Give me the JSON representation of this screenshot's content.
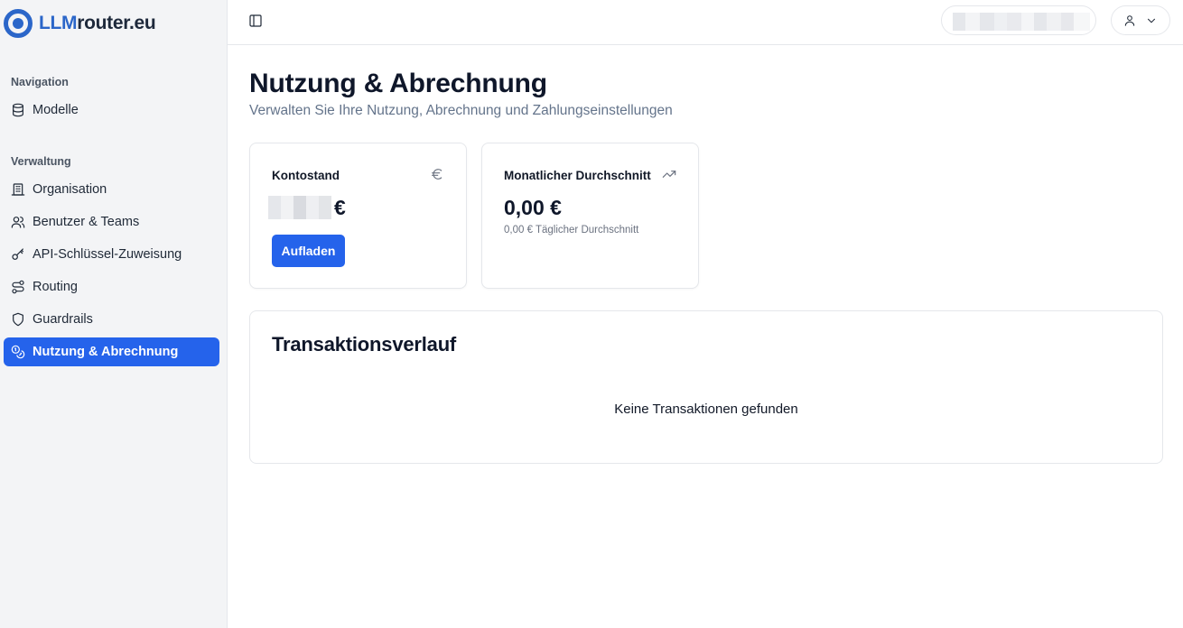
{
  "brand": {
    "prefix": "LLM",
    "suffix": "router.eu"
  },
  "sidebar": {
    "sections": [
      {
        "label": "Navigation",
        "items": [
          {
            "label": "Modelle",
            "icon": "database-icon"
          }
        ]
      },
      {
        "label": "Verwaltung",
        "items": [
          {
            "label": "Organisation",
            "icon": "building-icon"
          },
          {
            "label": "Benutzer & Teams",
            "icon": "users-icon"
          },
          {
            "label": "API-Schlüssel-Zuweisung",
            "icon": "key-icon"
          },
          {
            "label": "Routing",
            "icon": "route-icon"
          },
          {
            "label": "Guardrails",
            "icon": "shield-icon"
          },
          {
            "label": "Nutzung & Abrechnung",
            "icon": "coins-icon",
            "active": true
          }
        ]
      }
    ]
  },
  "main": {
    "title": "Nutzung & Abrechnung",
    "subtitle": "Verwalten Sie Ihre Nutzung, Abrechnung und Zahlungseinstellungen",
    "balance_card": {
      "title": "Kontostand",
      "icon": "euro-icon",
      "currency": "€",
      "button": "Aufladen"
    },
    "average_card": {
      "title": "Monatlicher Durchschnitt",
      "icon": "trending-up-icon",
      "value": "0,00 €",
      "note": "0,00 € Täglicher Durchschnitt"
    },
    "transactions": {
      "title": "Transaktionsverlauf",
      "empty": "Keine Transaktionen gefunden"
    }
  },
  "colors": {
    "accent": "#2563eb",
    "brand": "#2b66c9"
  }
}
